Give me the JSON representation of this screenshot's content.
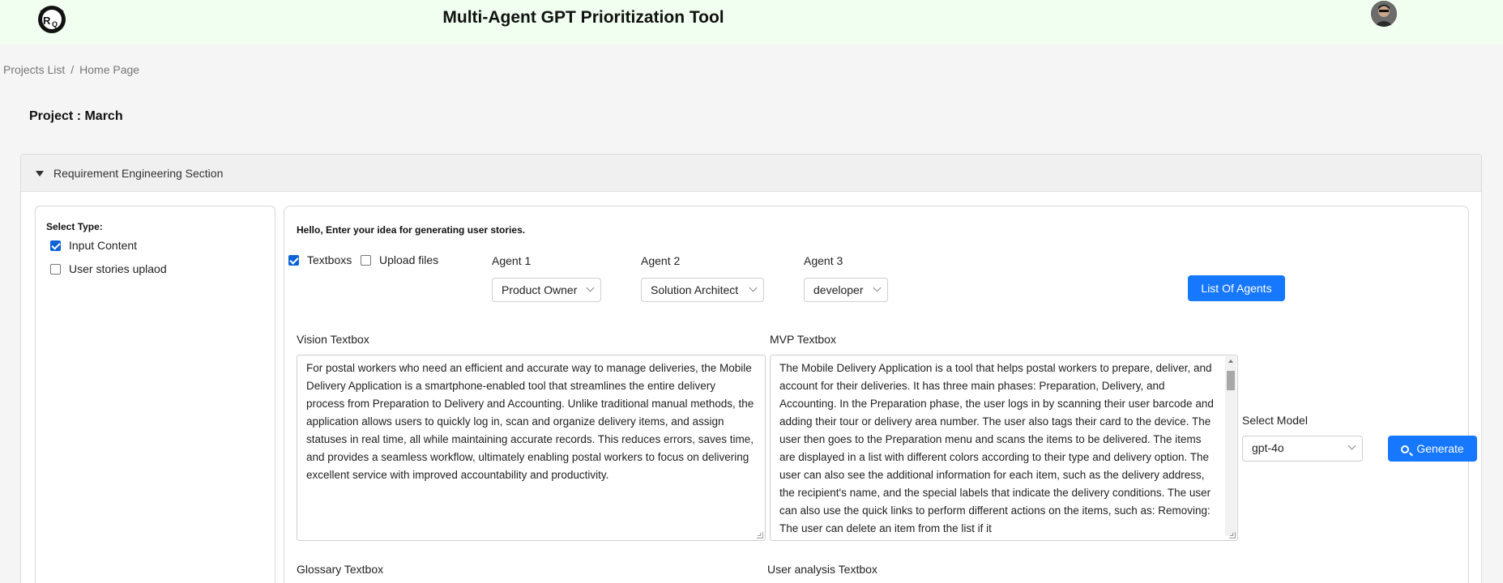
{
  "header": {
    "title": "Multi-Agent GPT Prioritization Tool",
    "logo_icon": "rq-logo-icon",
    "avatar_icon": "user-avatar"
  },
  "breadcrumb": {
    "items": [
      "Projects List",
      "Home Page"
    ],
    "separator": "/"
  },
  "project": {
    "title": "Project : March"
  },
  "section": {
    "label": "Requirement Engineering Section",
    "expanded": true
  },
  "select_type": {
    "title": "Select Type:",
    "options": [
      {
        "label": "Input Content",
        "checked": true
      },
      {
        "label": "User stories uplaod",
        "checked": false
      }
    ]
  },
  "main": {
    "hello": "Hello, Enter your idea for generating user stories.",
    "input_modes": [
      {
        "label": "Textboxs",
        "checked": true
      },
      {
        "label": "Upload files",
        "checked": false
      }
    ],
    "agents": [
      {
        "label": "Agent 1",
        "value": "Product Owner"
      },
      {
        "label": "Agent 2",
        "value": "Solution Architect"
      },
      {
        "label": "Agent 3",
        "value": "developer"
      }
    ],
    "list_agents_button": "List Of Agents",
    "vision": {
      "label": "Vision Textbox",
      "value": "For postal workers who need an efficient and accurate way to manage deliveries, the Mobile Delivery Application is a smartphone-enabled tool that streamlines the entire delivery process from Preparation to Delivery and Accounting. Unlike traditional manual methods, the application allows users to quickly log in, scan and organize delivery items, and assign statuses in real time, all while maintaining accurate records. This reduces errors, saves time, and provides a seamless workflow, ultimately enabling postal workers to focus on delivering excellent service with improved accountability and productivity."
    },
    "mvp": {
      "label": "MVP Textbox",
      "value": "The Mobile Delivery Application is a tool that helps postal workers to prepare, deliver, and account for their deliveries. It has three main phases: Preparation, Delivery, and Accounting. In the Preparation phase, the user logs in by scanning their user barcode and adding their tour or delivery area number. The user also tags their card to the device. The user then goes to the Preparation menu and scans the items to be delivered. The items are displayed in a list with different colors according to their type and delivery option. The user can also see the additional information for each item, such as the delivery address, the recipient's name, and the special labels that indicate the delivery conditions. The user can also use the quick links to perform different actions on the items, such as: Removing: The user can delete an item from the list if it"
    },
    "model": {
      "label": "Select Model",
      "value": "gpt-4o"
    },
    "generate_button": "Generate",
    "glossary_label": "Glossary Textbox",
    "user_analysis_label": "User analysis Textbox"
  },
  "colors": {
    "header_bg": "#f0fff0",
    "primary": "#1677ff",
    "checkbox": "#0b63d6"
  }
}
